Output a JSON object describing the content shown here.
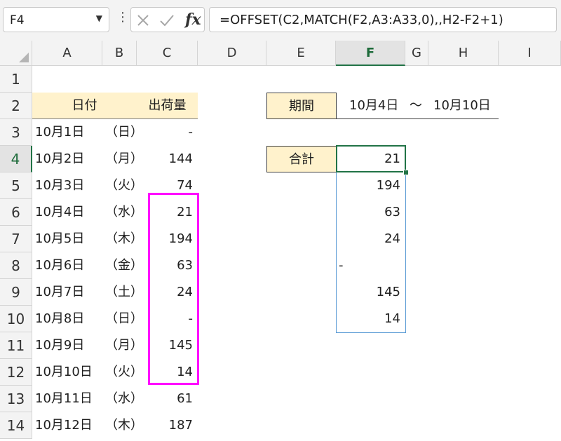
{
  "name_box": {
    "value": "F4"
  },
  "formula_bar": {
    "formula": "=OFFSET(C2,MATCH(F2,A3:A33,0),,H2-F2+1)",
    "fx_label": "fx"
  },
  "columns": [
    "A",
    "B",
    "C",
    "D",
    "E",
    "F",
    "G",
    "H",
    "I"
  ],
  "active_column": "F",
  "rows": [
    "1",
    "2",
    "3",
    "4",
    "5",
    "6",
    "7",
    "8",
    "9",
    "10",
    "11",
    "12",
    "13",
    "14"
  ],
  "active_row": "4",
  "table": {
    "header_date": "日付",
    "header_qty": "出荷量",
    "rows": [
      {
        "date": "10月1日",
        "weekday": "（日）",
        "qty": "-"
      },
      {
        "date": "10月2日",
        "weekday": "（月）",
        "qty": "144"
      },
      {
        "date": "10月3日",
        "weekday": "（火）",
        "qty": "74"
      },
      {
        "date": "10月4日",
        "weekday": "（水）",
        "qty": "21"
      },
      {
        "date": "10月5日",
        "weekday": "（木）",
        "qty": "194"
      },
      {
        "date": "10月6日",
        "weekday": "（金）",
        "qty": "63"
      },
      {
        "date": "10月7日",
        "weekday": "（土）",
        "qty": "24"
      },
      {
        "date": "10月8日",
        "weekday": "（日）",
        "qty": "-"
      },
      {
        "date": "10月9日",
        "weekday": "（月）",
        "qty": "145"
      },
      {
        "date": "10月10日",
        "weekday": "（火）",
        "qty": "14"
      },
      {
        "date": "10月11日",
        "weekday": "（水）",
        "qty": "61"
      },
      {
        "date": "10月12日",
        "weekday": "（木）",
        "qty": "187"
      }
    ]
  },
  "period": {
    "label": "期間",
    "start": "10月4日",
    "separator": "～",
    "end": "10月10日"
  },
  "total": {
    "label": "合計"
  },
  "spill_values": [
    "21",
    "194",
    "63",
    "24",
    "-",
    "145",
    "14"
  ],
  "colors": {
    "highlight_border": "#ff00ff",
    "selection": "#217346",
    "spill_border": "#5b9bd5",
    "label_fill": "#fff2cc"
  }
}
